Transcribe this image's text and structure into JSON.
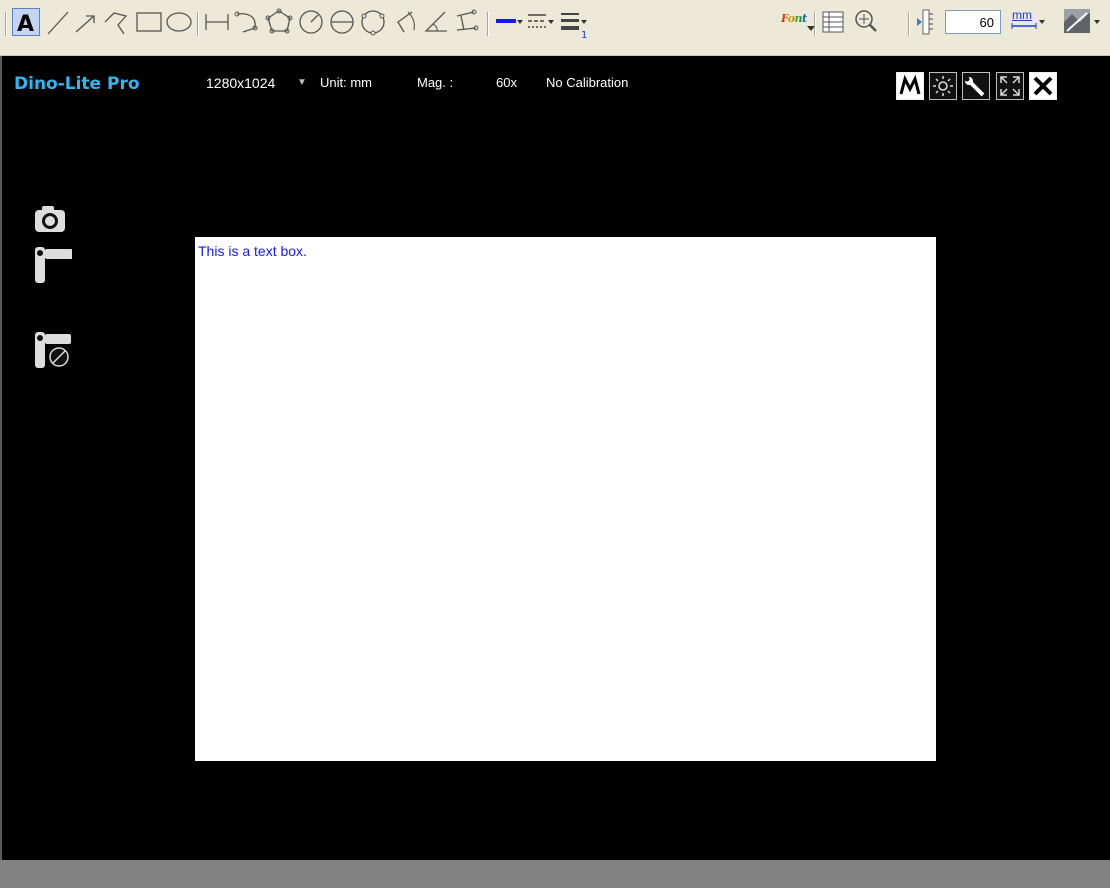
{
  "toolbar": {
    "tools": [
      {
        "name": "text-tool",
        "icon": "text-a-icon"
      },
      {
        "name": "line-tool",
        "icon": "line-icon"
      },
      {
        "name": "arrow-tool",
        "icon": "arrow-icon"
      },
      {
        "name": "polyline-tool",
        "icon": "polyline-icon"
      },
      {
        "name": "rectangle-tool",
        "icon": "rectangle-icon"
      },
      {
        "name": "ellipse-tool",
        "icon": "ellipse-icon"
      }
    ],
    "zoom_value": "60",
    "unit_label": "mm",
    "font_label": "Font",
    "colors": {
      "accent": "#1a1ae0",
      "line_color": "#1a1ae0"
    }
  },
  "viewer": {
    "title": "Dino-Lite Pro",
    "resolution": "1280x1024",
    "unit_info": "Unit: mm",
    "mag_label": "Mag. :",
    "mag_value": "60x",
    "calibration": "No Calibration",
    "title_color": "#2fb8f0"
  },
  "text_box": {
    "content": "This is a text box."
  }
}
